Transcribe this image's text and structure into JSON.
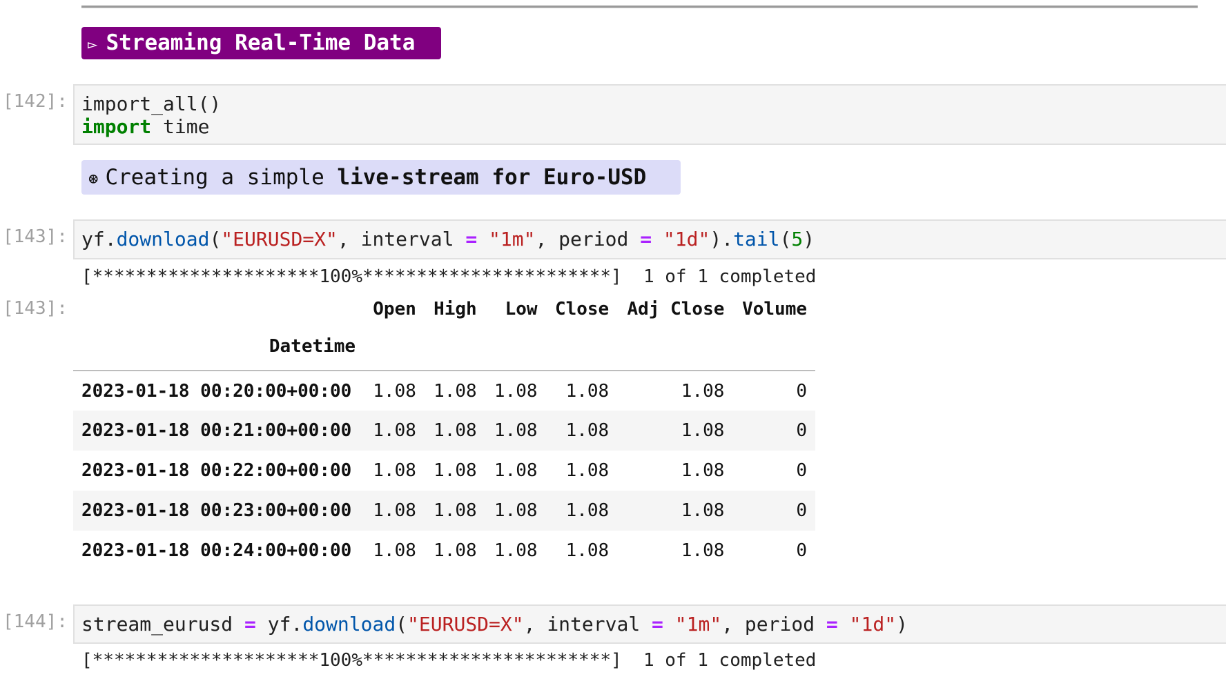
{
  "section_heading": {
    "icon": "triangle-right-icon",
    "icon_glyph": "▻",
    "text": "Streaming Real-Time Data",
    "background_color": "#800080"
  },
  "cells": [
    {
      "prompt": "[142]:",
      "type": "code",
      "lines": [
        [
          {
            "t": "import_all()",
            "c": ""
          }
        ],
        [
          {
            "t": "import",
            "c": "kw"
          },
          {
            "t": " time",
            "c": ""
          }
        ]
      ]
    },
    {
      "type": "markdown",
      "icon": "asterisk-circle-icon",
      "icon_glyph": "⊛",
      "text_plain": "Creating a simple ",
      "text_bold": "live-stream for Euro-USD",
      "background_color": "#dcdcf8"
    },
    {
      "prompt": "[143]:",
      "type": "code",
      "lines": [
        [
          {
            "t": "yf.",
            "c": ""
          },
          {
            "t": "download",
            "c": "fn"
          },
          {
            "t": "(",
            "c": ""
          },
          {
            "t": "\"EURUSD=X\"",
            "c": "str"
          },
          {
            "t": ", interval ",
            "c": ""
          },
          {
            "t": "=",
            "c": "op"
          },
          {
            "t": " ",
            "c": ""
          },
          {
            "t": "\"1m\"",
            "c": "str"
          },
          {
            "t": ", period ",
            "c": ""
          },
          {
            "t": "=",
            "c": "op"
          },
          {
            "t": " ",
            "c": ""
          },
          {
            "t": "\"1d\"",
            "c": "str"
          },
          {
            "t": ").",
            "c": ""
          },
          {
            "t": "tail",
            "c": "fn"
          },
          {
            "t": "(",
            "c": ""
          },
          {
            "t": "5",
            "c": "num"
          },
          {
            "t": ")",
            "c": ""
          }
        ]
      ],
      "stderr": "[*********************100%***********************]  1 of 1 completed",
      "output_prompt": "[143]:",
      "dataframe": {
        "columns": [
          "Open",
          "High",
          "Low",
          "Close",
          "Adj Close",
          "Volume"
        ],
        "index_name": "Datetime",
        "rows": [
          {
            "index": "2023-01-18 00:20:00+00:00",
            "values": [
              "1.08",
              "1.08",
              "1.08",
              "1.08",
              "1.08",
              "0"
            ]
          },
          {
            "index": "2023-01-18 00:21:00+00:00",
            "values": [
              "1.08",
              "1.08",
              "1.08",
              "1.08",
              "1.08",
              "0"
            ]
          },
          {
            "index": "2023-01-18 00:22:00+00:00",
            "values": [
              "1.08",
              "1.08",
              "1.08",
              "1.08",
              "1.08",
              "0"
            ]
          },
          {
            "index": "2023-01-18 00:23:00+00:00",
            "values": [
              "1.08",
              "1.08",
              "1.08",
              "1.08",
              "1.08",
              "0"
            ]
          },
          {
            "index": "2023-01-18 00:24:00+00:00",
            "values": [
              "1.08",
              "1.08",
              "1.08",
              "1.08",
              "1.08",
              "0"
            ]
          }
        ]
      }
    },
    {
      "prompt": "[144]:",
      "type": "code",
      "lines": [
        [
          {
            "t": "stream_eurusd ",
            "c": ""
          },
          {
            "t": "=",
            "c": "op"
          },
          {
            "t": " yf.",
            "c": ""
          },
          {
            "t": "download",
            "c": "fn"
          },
          {
            "t": "(",
            "c": ""
          },
          {
            "t": "\"EURUSD=X\"",
            "c": "str"
          },
          {
            "t": ", interval ",
            "c": ""
          },
          {
            "t": "=",
            "c": "op"
          },
          {
            "t": " ",
            "c": ""
          },
          {
            "t": "\"1m\"",
            "c": "str"
          },
          {
            "t": ", period ",
            "c": ""
          },
          {
            "t": "=",
            "c": "op"
          },
          {
            "t": " ",
            "c": ""
          },
          {
            "t": "\"1d\"",
            "c": "str"
          },
          {
            "t": ")",
            "c": ""
          }
        ]
      ],
      "stderr": "[*********************100%***********************]  1 of 1 completed"
    }
  ]
}
